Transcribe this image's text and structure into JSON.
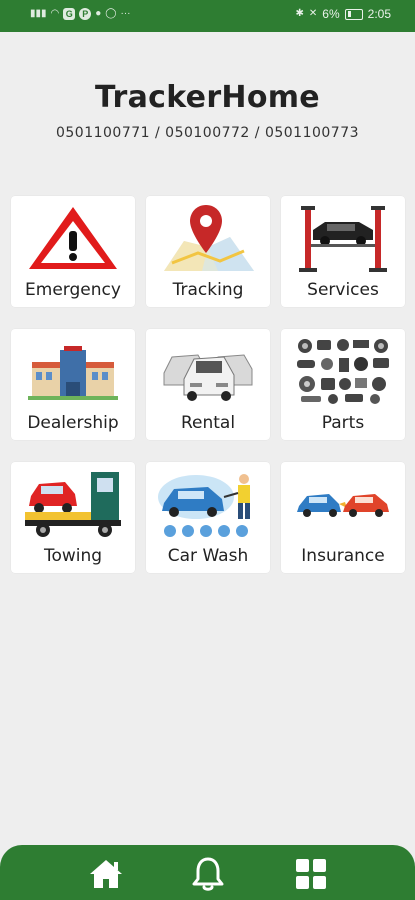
{
  "status_bar": {
    "battery_percent": "6%",
    "time": "2:05",
    "dots": "···",
    "app_badges": [
      "G",
      "P"
    ]
  },
  "header": {
    "title": "TrackerHome",
    "phones": "0501100771 / 050100772 / 0501100773"
  },
  "tiles": [
    {
      "label": "Emergency",
      "icon": "warning-triangle-icon"
    },
    {
      "label": "Tracking",
      "icon": "map-pin-icon"
    },
    {
      "label": "Services",
      "icon": "car-lift-icon"
    },
    {
      "label": "Dealership",
      "icon": "dealership-building-icon"
    },
    {
      "label": "Rental",
      "icon": "rental-cars-icon"
    },
    {
      "label": "Parts",
      "icon": "auto-parts-icon"
    },
    {
      "label": "Towing",
      "icon": "tow-truck-icon"
    },
    {
      "label": "Car Wash",
      "icon": "car-wash-icon"
    },
    {
      "label": "Insurance",
      "icon": "car-collision-icon"
    }
  ],
  "bottom_nav": {
    "items": [
      {
        "icon": "home-icon"
      },
      {
        "icon": "bell-icon"
      },
      {
        "icon": "grid-icon"
      }
    ]
  },
  "colors": {
    "brand_green": "#2e7d32",
    "background": "#eeeeee",
    "tile": "#ffffff",
    "warning_red": "#e11b1b"
  }
}
